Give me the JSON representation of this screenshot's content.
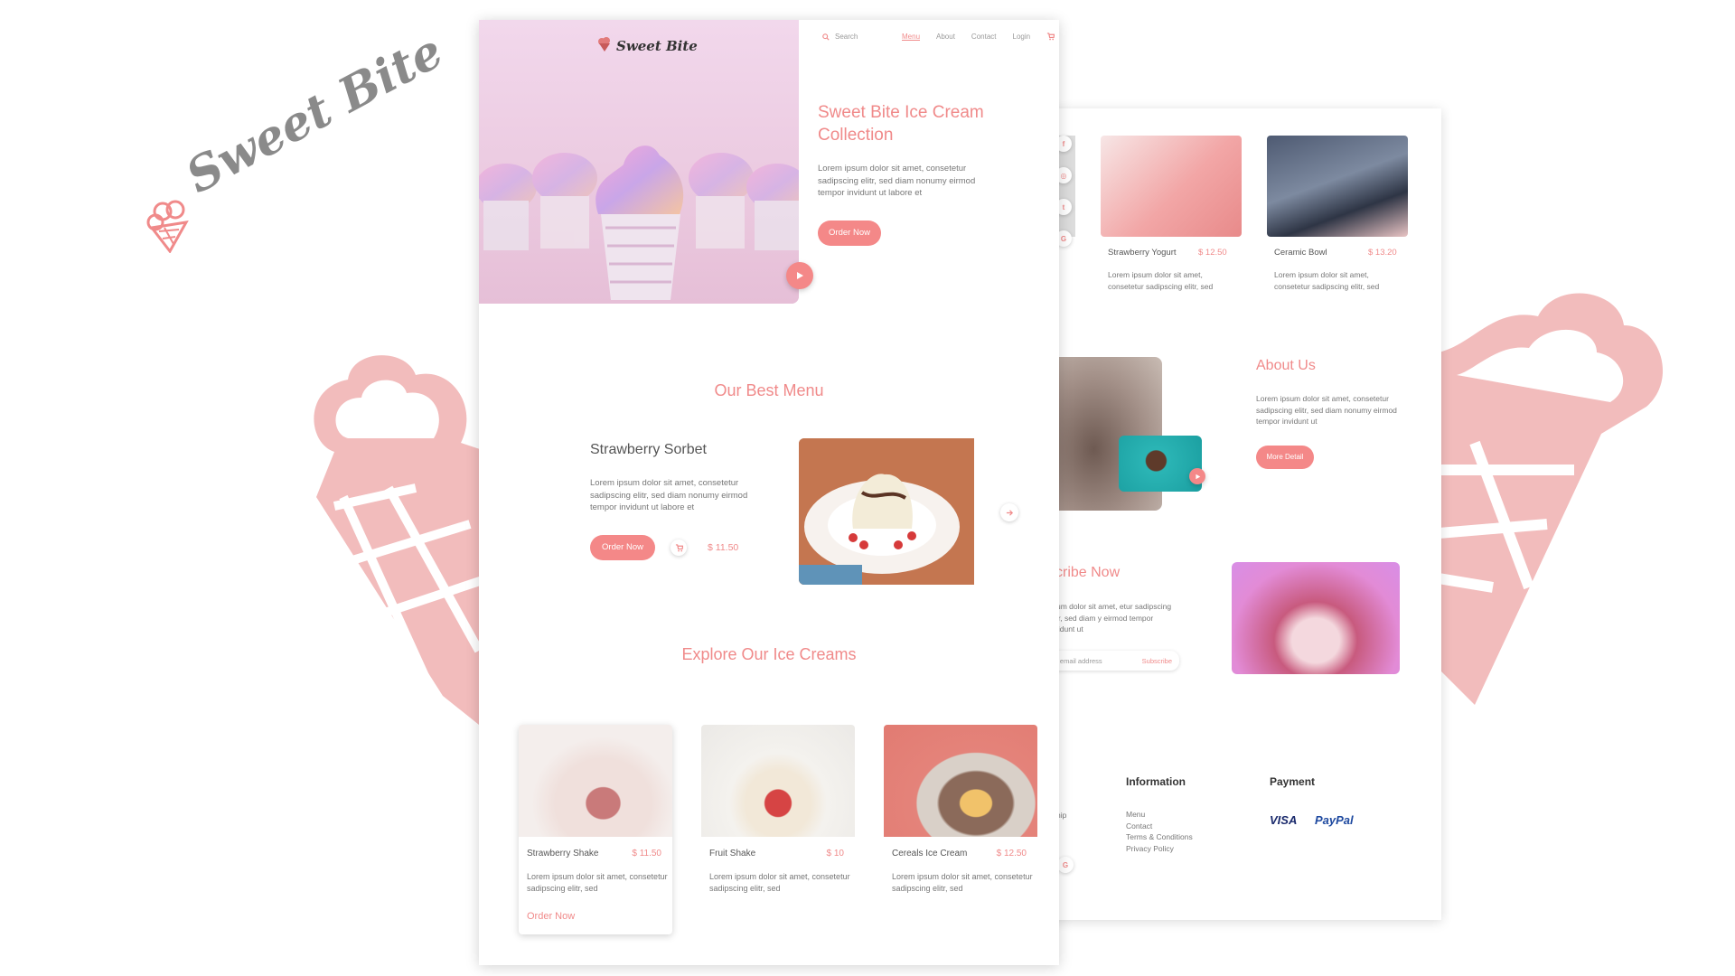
{
  "showcase": {
    "logo_text": "Sweet Bite"
  },
  "header": {
    "brand": "Sweet Bite",
    "search_placeholder": "Search",
    "nav": [
      "Menu",
      "About",
      "Contact",
      "Login"
    ]
  },
  "hero": {
    "title": "Sweet Bite Ice Cream Collection",
    "description": "Lorem ipsum dolor sit amet, consetetur sadipscing elitr, sed diam nonumy eirmod tempor invidunt ut labore et",
    "button": "Order Now"
  },
  "best_menu": {
    "title": "Our Best Menu",
    "item_name": "Strawberry Sorbet",
    "description": "Lorem ipsum dolor sit amet, consetetur sadipscing elitr, sed diam nonumy eirmod tempor invidunt ut labore et",
    "button": "Order Now",
    "price": "$ 11.50"
  },
  "explore": {
    "title": "Explore Our Ice Creams",
    "products": [
      {
        "name": "Strawberry Shake",
        "price": "$ 11.50",
        "description": "Lorem ipsum dolor sit amet, consetetur sadipscing elitr, sed",
        "link": "Order Now"
      },
      {
        "name": "Fruit Shake",
        "price": "$ 10",
        "description": "Lorem ipsum dolor sit amet, consetetur sadipscing elitr, sed"
      },
      {
        "name": "Cereals Ice Cream",
        "price": "$ 12.50",
        "description": "Lorem ipsum dolor sit amet, consetetur sadipscing elitr, sed"
      }
    ]
  },
  "back_page": {
    "products": [
      {
        "name": "Strawberry Yogurt",
        "price": "$ 12.50",
        "description": "Lorem ipsum dolor sit amet, consetetur sadipscing elitr, sed"
      },
      {
        "name": "Ceramic Bowl",
        "price": "$ 13.20",
        "description": "Lorem ipsum dolor sit amet, consetetur sadipscing elitr, sed"
      }
    ],
    "about": {
      "title": "About Us",
      "description": "Lorem ipsum dolor sit amet, consetetur sadipscing elitr, sed diam nonumy eirmod tempor invidunt ut",
      "button": "More Detail"
    },
    "subscribe": {
      "title": "scribe Now",
      "description": "psum dolor sit amet, etur sadipscing elitr, sed diam y eirmod tempor invidunt ut",
      "input_placeholder": "our email address",
      "button": "Subscribe"
    },
    "footer": {
      "partial_link": "nship",
      "information_title": "Information",
      "information_links": [
        "Menu",
        "Contact",
        "Terms & Conditions",
        "Privacy Policy"
      ],
      "payment_title": "Payment",
      "payment_methods": [
        "VISA",
        "PayPal"
      ]
    }
  },
  "icons": {
    "social": [
      "facebook-icon",
      "instagram-icon",
      "twitter-icon",
      "google-plus-icon"
    ]
  },
  "colors": {
    "accent": "#f08a8a",
    "button": "#f48888",
    "decor": "#f2bcbc"
  }
}
